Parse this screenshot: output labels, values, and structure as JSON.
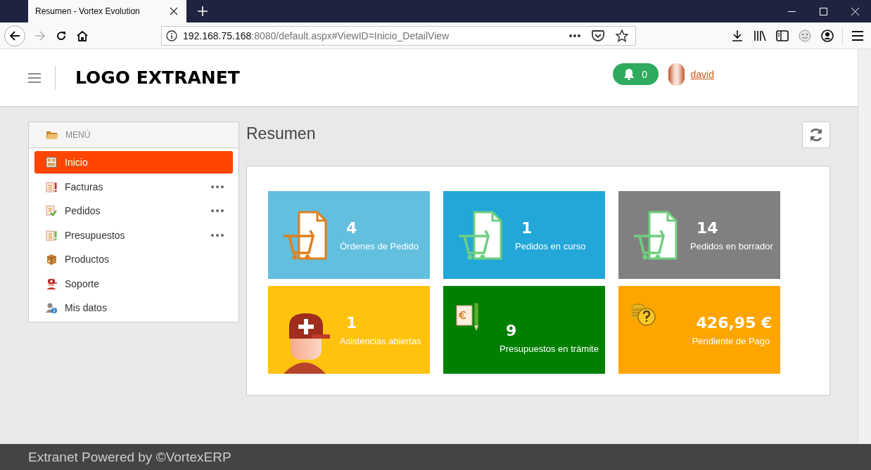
{
  "browser": {
    "tab_title": "Resumen - Vortex Evolution",
    "url_host": "192.168.75.168",
    "url_rest": ":8080/default.aspx#ViewID=Inicio_DetailView",
    "forward_disabled": true
  },
  "header": {
    "logo": "LOGO EXTRANET",
    "notifications": "0",
    "user": "david"
  },
  "menu": {
    "title": "MENÚ",
    "items": [
      {
        "label": "Inicio",
        "kind": "home",
        "selected": true,
        "more": false
      },
      {
        "label": "Facturas",
        "kind": "invoices",
        "selected": false,
        "more": true
      },
      {
        "label": "Pedidos",
        "kind": "orders",
        "selected": false,
        "more": true
      },
      {
        "label": "Presupuestos",
        "kind": "budgets",
        "selected": false,
        "more": true
      },
      {
        "label": "Productos",
        "kind": "products",
        "selected": false,
        "more": false
      },
      {
        "label": "Soporte",
        "kind": "support",
        "selected": false,
        "more": false
      },
      {
        "label": "Mis datos",
        "kind": "profile",
        "selected": false,
        "more": false
      }
    ]
  },
  "page_title": "Resumen",
  "tiles": [
    {
      "kind": "orders",
      "color": "#62bfde",
      "value": "4",
      "label": "Órdenes de Pedido"
    },
    {
      "kind": "orders-active",
      "color": "#22a7d8",
      "value": "1",
      "label": "Pedidos en curso"
    },
    {
      "kind": "orders-active",
      "color": "#808080",
      "value": "14",
      "label": "Pedidos en borrador"
    },
    {
      "kind": "support",
      "color": "#ffc20e",
      "value": "1",
      "label": "Asistencias abiertas"
    },
    {
      "kind": "budget",
      "color": "#008000",
      "value": "9",
      "label": "Presupuestos en trámite"
    },
    {
      "kind": "payment",
      "color": "#ffa500",
      "value": "426,95 €",
      "label": "Pendiente de Pago"
    }
  ],
  "footer": "Extranet Powered by ©VortexERP"
}
